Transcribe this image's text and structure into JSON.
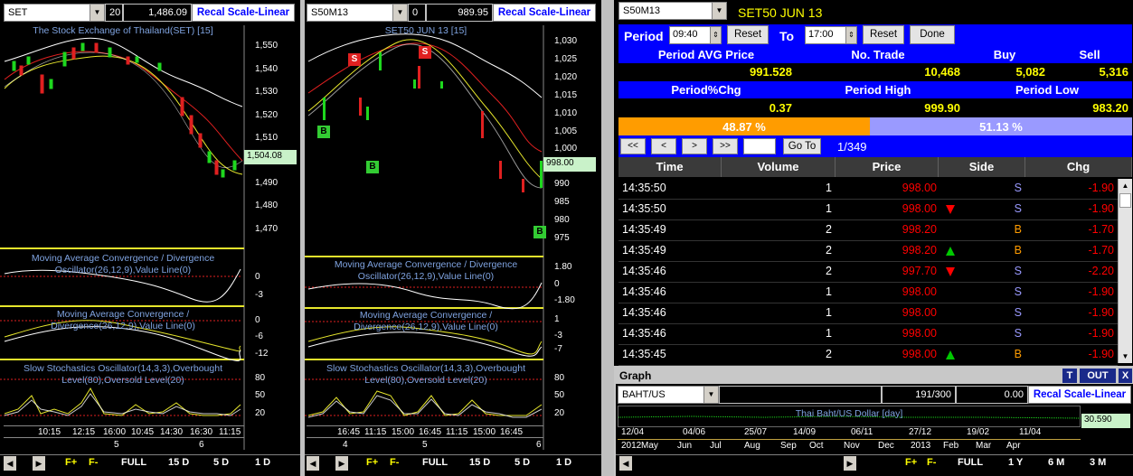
{
  "left_chart": {
    "symbol": "SET",
    "spin_value": "20",
    "last_value": "1,486.09",
    "recal_label": "Recal Scale-Linear",
    "title": "The Stock Exchange of Thailand(SET) [15]",
    "y_ticks": [
      "1,550",
      "1,540",
      "1,530",
      "1,520",
      "1,510",
      "1,500",
      "1,490",
      "1,480",
      "1,470"
    ],
    "price_tag": "1,504.08",
    "macd1_title_a": "Moving Average Convergence / Divergence",
    "macd1_title_b": "Oscillator(26,12,9),Value Line(0)",
    "macd1_ticks": [
      "0",
      "-3"
    ],
    "macd2_title_a": "Moving Average Convergence /",
    "macd2_title_b": "Divergence(26,12,9),Value Line(0)",
    "macd2_ticks": [
      "0",
      "-6",
      "-12"
    ],
    "stoch_title_a": "Slow Stochastics Oscillator(14,3,3),Overbought",
    "stoch_title_b": "Level(80),Oversold Level(20)",
    "stoch_ticks": [
      "80",
      "50",
      "20"
    ],
    "x_ticks": [
      "10:15",
      "12:15",
      "16:00",
      "10:45",
      "14:30",
      "16:30",
      "11:15"
    ],
    "day_ticks": [
      "5",
      "6"
    ],
    "buttons": [
      "FULL",
      "15 D",
      "5 D",
      "1 D"
    ],
    "markers": []
  },
  "mid_chart": {
    "symbol": "S50M13",
    "spin_value": "0",
    "last_value": "989.95",
    "recal_label": "Recal Scale-Linear",
    "title": "SET50 JUN 13   [15]",
    "y_ticks": [
      "1,030",
      "1,025",
      "1,020",
      "1,015",
      "1,010",
      "1,005",
      "1,000",
      "995",
      "990",
      "985",
      "980",
      "975"
    ],
    "price_tag": "998.00",
    "macd1_title_a": "Moving Average Convergence / Divergence",
    "macd1_title_b": "Oscillator(26,12,9),Value Line(0)",
    "macd1_ticks": [
      "1.80",
      "0",
      "-1.80"
    ],
    "macd2_title_a": "Moving Average Convergence /",
    "macd2_title_b": "Divergence(26,12,9),Value Line(0)",
    "macd2_ticks": [
      "1",
      "-3",
      "-7"
    ],
    "stoch_title_a": "Slow Stochastics Oscillator(14,3,3),Overbought",
    "stoch_title_b": "Level(80),Oversold Level(20)",
    "stoch_ticks": [
      "80",
      "50",
      "20"
    ],
    "x_ticks": [
      "16:45",
      "11:15",
      "15:00",
      "16:45",
      "11:15",
      "15:00",
      "16:45"
    ],
    "day_ticks": [
      "4",
      "5",
      "6"
    ],
    "buttons": [
      "FULL",
      "15 D",
      "5 D",
      "1 D"
    ],
    "markers": [
      "S",
      "S",
      "B",
      "B",
      "B"
    ]
  },
  "ticker": {
    "symbol": "S50M13",
    "name": "SET50 JUN 13",
    "period_label": "Period",
    "from_time": "09:40",
    "reset_label": "Reset",
    "to_label": "To",
    "to_time": "17:00",
    "done_label": "Done",
    "stats_headers": [
      "Period AVG Price",
      "No. Trade",
      "Buy",
      "Sell"
    ],
    "stats_values": [
      "991.528",
      "10,468",
      "5,082",
      "5,316"
    ],
    "stats_headers2": [
      "Period%Chg",
      "Period High",
      "Period Low"
    ],
    "stats_values2": [
      "0.37",
      "999.90",
      "983.20"
    ],
    "buy_pct": "48.87 %",
    "buy_fraction": 0.4887,
    "sell_pct": "51.13 %",
    "nav_first": "<<",
    "nav_prev": "<",
    "nav_next": ">",
    "nav_last": ">>",
    "goto_label": "Go To",
    "page_info": "1/349",
    "columns": [
      "Time",
      "Volume",
      "Price",
      "Side",
      "Chg"
    ],
    "rows": [
      {
        "time": "14:35:50",
        "volume": "1",
        "price": "998.00",
        "dir": "",
        "side": "S",
        "chg": "-1.90"
      },
      {
        "time": "14:35:50",
        "volume": "1",
        "price": "998.00",
        "dir": "down",
        "side": "S",
        "chg": "-1.90"
      },
      {
        "time": "14:35:49",
        "volume": "2",
        "price": "998.20",
        "dir": "",
        "side": "B",
        "chg": "-1.70"
      },
      {
        "time": "14:35:49",
        "volume": "2",
        "price": "998.20",
        "dir": "up",
        "side": "B",
        "chg": "-1.70"
      },
      {
        "time": "14:35:46",
        "volume": "2",
        "price": "997.70",
        "dir": "down",
        "side": "S",
        "chg": "-2.20"
      },
      {
        "time": "14:35:46",
        "volume": "1",
        "price": "998.00",
        "dir": "",
        "side": "S",
        "chg": "-1.90"
      },
      {
        "time": "14:35:46",
        "volume": "1",
        "price": "998.00",
        "dir": "",
        "side": "S",
        "chg": "-1.90"
      },
      {
        "time": "14:35:46",
        "volume": "1",
        "price": "998.00",
        "dir": "",
        "side": "S",
        "chg": "-1.90"
      },
      {
        "time": "14:35:45",
        "volume": "2",
        "price": "998.00",
        "dir": "up",
        "side": "B",
        "chg": "-1.90"
      }
    ]
  },
  "graph": {
    "header": "Graph",
    "btn_t": "T",
    "btn_out": "OUT",
    "btn_x": "X",
    "symbol": "BAHT/US",
    "counter": "191/300",
    "value": "0.00",
    "recal_label": "Recal Scale-Linear",
    "title": "Thai Baht/US Dollar [day]",
    "price_tag": "30.590",
    "date_ticks": [
      "12/04",
      "04/06",
      "25/07",
      "14/09",
      "06/11",
      "27/12",
      "19/02",
      "11/04"
    ],
    "month_ticks": [
      "2012",
      "May",
      "Jun",
      "Jul",
      "Aug",
      "Sep",
      "Oct",
      "Nov",
      "Dec",
      "2013",
      "Feb",
      "Mar",
      "Apr"
    ],
    "buttons": [
      "FULL",
      "1 Y",
      "6 M",
      "3 M"
    ]
  },
  "colors": {
    "accent_blue": "#0000ff",
    "buy_orange": "#ff9c00",
    "sell_purple": "#9a9aff",
    "price_red": "#ff0000",
    "value_yellow": "#ffff00"
  }
}
